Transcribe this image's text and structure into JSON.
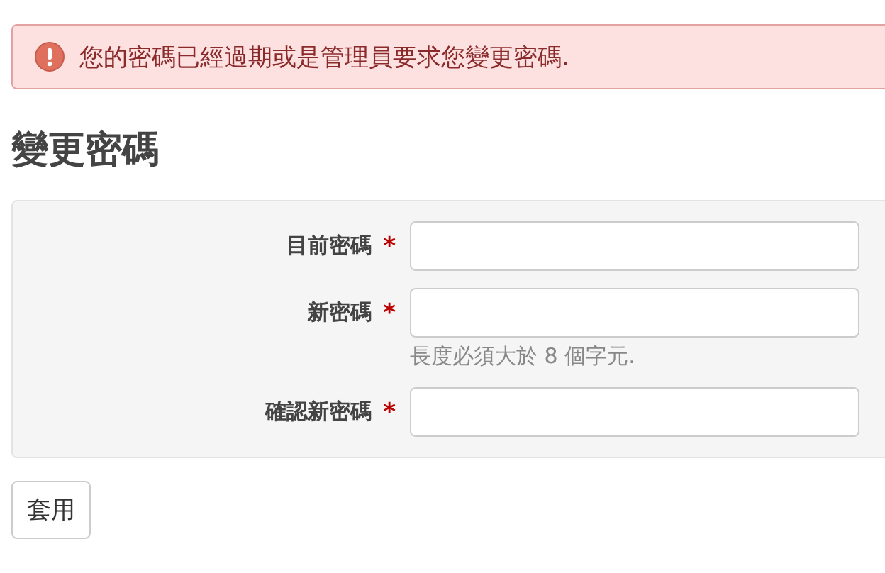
{
  "alert": {
    "kind": "error",
    "message": "您的密碼已經過期或是管理員要求您變更密碼."
  },
  "heading": "變更密碼",
  "fields": [
    {
      "label": "目前密碼",
      "marker": "*"
    },
    {
      "label": "新密碼",
      "marker": "*",
      "help": "長度必須大於 8 個字元."
    },
    {
      "label": "確認新密碼",
      "marker": "*"
    }
  ],
  "submit": "套用"
}
